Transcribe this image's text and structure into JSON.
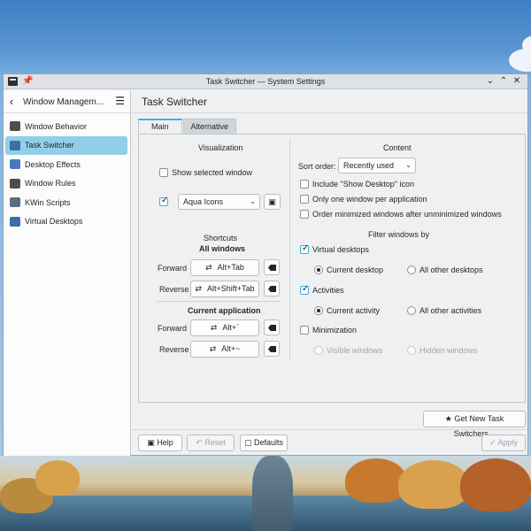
{
  "window": {
    "title": "Task Switcher — System Settings",
    "controls": [
      "⌄",
      "⌃",
      "✕"
    ]
  },
  "sidebar": {
    "title": "Window Managem...",
    "items": [
      {
        "label": "Window Behavior",
        "icon": "window-behavior-icon",
        "color": "#4d4d4d"
      },
      {
        "label": "Task Switcher",
        "icon": "task-switcher-icon",
        "color": "#3b6ea5"
      },
      {
        "label": "Desktop Effects",
        "icon": "desktop-effects-icon",
        "color": "#4a78c0"
      },
      {
        "label": "Window Rules",
        "icon": "window-rules-icon",
        "color": "#4d4d4d"
      },
      {
        "label": "KWin Scripts",
        "icon": "kwin-scripts-icon",
        "color": "#5a6e80"
      },
      {
        "label": "Virtual Desktops",
        "icon": "virtual-desktops-icon",
        "color": "#3b6ea5"
      }
    ],
    "active_index": 1
  },
  "main": {
    "title": "Task Switcher",
    "tabs": [
      "Main",
      "Alternative"
    ]
  },
  "visualization": {
    "heading": "Visualization",
    "show_selected_window": "Show selected window",
    "show_selected_checked": false,
    "style_checked": true,
    "style_value": "Aqua Icons"
  },
  "shortcuts": {
    "heading": "Shortcuts",
    "all_windows": "All windows",
    "current_application": "Current application",
    "forward": "Forward",
    "reverse": "Reverse",
    "all_forward": "Alt+Tab",
    "all_reverse": "Alt+Shift+Tab",
    "app_forward": "Alt+`",
    "app_reverse": "Alt+~"
  },
  "content": {
    "heading": "Content",
    "sort_order_label": "Sort order:",
    "sort_order_value": "Recently used",
    "include_show_desktop": "Include \"Show Desktop\" icon",
    "one_window_per_app": "Only one window per application",
    "order_minimized": "Order minimized windows after unminimized windows"
  },
  "filter": {
    "heading": "Filter windows by",
    "virtual_desktops": "Virtual desktops",
    "current_desktop": "Current desktop",
    "all_other_desktops": "All other desktops",
    "activities": "Activities",
    "current_activity": "Current activity",
    "all_other_activities": "All other activities",
    "minimization": "Minimization",
    "visible_windows": "Visible windows",
    "hidden_windows": "Hidden windows"
  },
  "buttons": {
    "get_new": "Get New Task Switchers...",
    "help": "Help",
    "reset": "Reset",
    "defaults": "Defaults",
    "apply": "Apply"
  },
  "colors": {
    "accent": "#3daee9",
    "selection": "#93cee9"
  }
}
